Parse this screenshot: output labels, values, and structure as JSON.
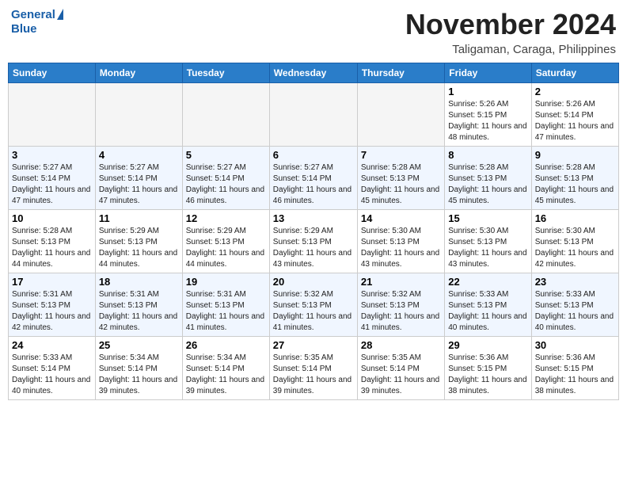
{
  "header": {
    "logo_line1": "General",
    "logo_line2": "Blue",
    "month": "November 2024",
    "location": "Taligaman, Caraga, Philippines"
  },
  "columns": [
    "Sunday",
    "Monday",
    "Tuesday",
    "Wednesday",
    "Thursday",
    "Friday",
    "Saturday"
  ],
  "weeks": [
    {
      "row_class": "row-odd",
      "days": [
        {
          "num": "",
          "text": "",
          "empty": true
        },
        {
          "num": "",
          "text": "",
          "empty": true
        },
        {
          "num": "",
          "text": "",
          "empty": true
        },
        {
          "num": "",
          "text": "",
          "empty": true
        },
        {
          "num": "",
          "text": "",
          "empty": true
        },
        {
          "num": "1",
          "text": "Sunrise: 5:26 AM\nSunset: 5:15 PM\nDaylight: 11 hours and 48 minutes.",
          "empty": false
        },
        {
          "num": "2",
          "text": "Sunrise: 5:26 AM\nSunset: 5:14 PM\nDaylight: 11 hours and 47 minutes.",
          "empty": false
        }
      ]
    },
    {
      "row_class": "row-even",
      "days": [
        {
          "num": "3",
          "text": "Sunrise: 5:27 AM\nSunset: 5:14 PM\nDaylight: 11 hours and 47 minutes.",
          "empty": false
        },
        {
          "num": "4",
          "text": "Sunrise: 5:27 AM\nSunset: 5:14 PM\nDaylight: 11 hours and 47 minutes.",
          "empty": false
        },
        {
          "num": "5",
          "text": "Sunrise: 5:27 AM\nSunset: 5:14 PM\nDaylight: 11 hours and 46 minutes.",
          "empty": false
        },
        {
          "num": "6",
          "text": "Sunrise: 5:27 AM\nSunset: 5:14 PM\nDaylight: 11 hours and 46 minutes.",
          "empty": false
        },
        {
          "num": "7",
          "text": "Sunrise: 5:28 AM\nSunset: 5:13 PM\nDaylight: 11 hours and 45 minutes.",
          "empty": false
        },
        {
          "num": "8",
          "text": "Sunrise: 5:28 AM\nSunset: 5:13 PM\nDaylight: 11 hours and 45 minutes.",
          "empty": false
        },
        {
          "num": "9",
          "text": "Sunrise: 5:28 AM\nSunset: 5:13 PM\nDaylight: 11 hours and 45 minutes.",
          "empty": false
        }
      ]
    },
    {
      "row_class": "row-odd",
      "days": [
        {
          "num": "10",
          "text": "Sunrise: 5:28 AM\nSunset: 5:13 PM\nDaylight: 11 hours and 44 minutes.",
          "empty": false
        },
        {
          "num": "11",
          "text": "Sunrise: 5:29 AM\nSunset: 5:13 PM\nDaylight: 11 hours and 44 minutes.",
          "empty": false
        },
        {
          "num": "12",
          "text": "Sunrise: 5:29 AM\nSunset: 5:13 PM\nDaylight: 11 hours and 44 minutes.",
          "empty": false
        },
        {
          "num": "13",
          "text": "Sunrise: 5:29 AM\nSunset: 5:13 PM\nDaylight: 11 hours and 43 minutes.",
          "empty": false
        },
        {
          "num": "14",
          "text": "Sunrise: 5:30 AM\nSunset: 5:13 PM\nDaylight: 11 hours and 43 minutes.",
          "empty": false
        },
        {
          "num": "15",
          "text": "Sunrise: 5:30 AM\nSunset: 5:13 PM\nDaylight: 11 hours and 43 minutes.",
          "empty": false
        },
        {
          "num": "16",
          "text": "Sunrise: 5:30 AM\nSunset: 5:13 PM\nDaylight: 11 hours and 42 minutes.",
          "empty": false
        }
      ]
    },
    {
      "row_class": "row-even",
      "days": [
        {
          "num": "17",
          "text": "Sunrise: 5:31 AM\nSunset: 5:13 PM\nDaylight: 11 hours and 42 minutes.",
          "empty": false
        },
        {
          "num": "18",
          "text": "Sunrise: 5:31 AM\nSunset: 5:13 PM\nDaylight: 11 hours and 42 minutes.",
          "empty": false
        },
        {
          "num": "19",
          "text": "Sunrise: 5:31 AM\nSunset: 5:13 PM\nDaylight: 11 hours and 41 minutes.",
          "empty": false
        },
        {
          "num": "20",
          "text": "Sunrise: 5:32 AM\nSunset: 5:13 PM\nDaylight: 11 hours and 41 minutes.",
          "empty": false
        },
        {
          "num": "21",
          "text": "Sunrise: 5:32 AM\nSunset: 5:13 PM\nDaylight: 11 hours and 41 minutes.",
          "empty": false
        },
        {
          "num": "22",
          "text": "Sunrise: 5:33 AM\nSunset: 5:13 PM\nDaylight: 11 hours and 40 minutes.",
          "empty": false
        },
        {
          "num": "23",
          "text": "Sunrise: 5:33 AM\nSunset: 5:13 PM\nDaylight: 11 hours and 40 minutes.",
          "empty": false
        }
      ]
    },
    {
      "row_class": "row-odd",
      "days": [
        {
          "num": "24",
          "text": "Sunrise: 5:33 AM\nSunset: 5:14 PM\nDaylight: 11 hours and 40 minutes.",
          "empty": false
        },
        {
          "num": "25",
          "text": "Sunrise: 5:34 AM\nSunset: 5:14 PM\nDaylight: 11 hours and 39 minutes.",
          "empty": false
        },
        {
          "num": "26",
          "text": "Sunrise: 5:34 AM\nSunset: 5:14 PM\nDaylight: 11 hours and 39 minutes.",
          "empty": false
        },
        {
          "num": "27",
          "text": "Sunrise: 5:35 AM\nSunset: 5:14 PM\nDaylight: 11 hours and 39 minutes.",
          "empty": false
        },
        {
          "num": "28",
          "text": "Sunrise: 5:35 AM\nSunset: 5:14 PM\nDaylight: 11 hours and 39 minutes.",
          "empty": false
        },
        {
          "num": "29",
          "text": "Sunrise: 5:36 AM\nSunset: 5:15 PM\nDaylight: 11 hours and 38 minutes.",
          "empty": false
        },
        {
          "num": "30",
          "text": "Sunrise: 5:36 AM\nSunset: 5:15 PM\nDaylight: 11 hours and 38 minutes.",
          "empty": false
        }
      ]
    }
  ]
}
